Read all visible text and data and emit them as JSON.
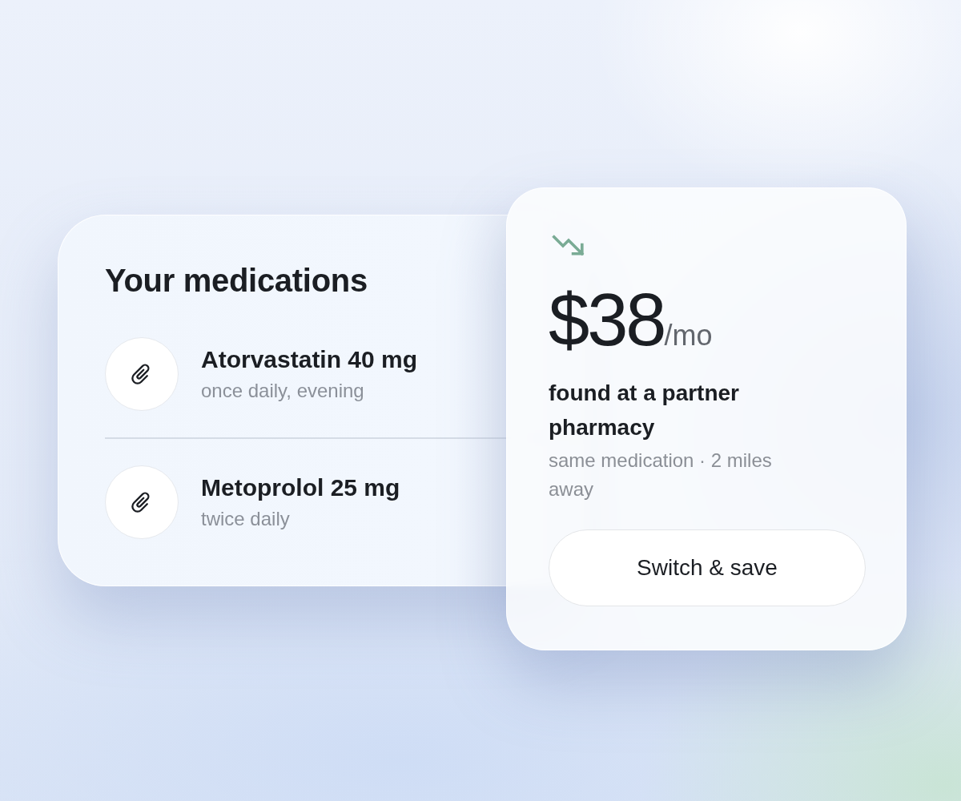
{
  "medications_card": {
    "title": "Your medications",
    "items": [
      {
        "name": "Atorvastatin 40 mg",
        "schedule": "once daily, evening"
      },
      {
        "name": "Metoprolol 25 mg",
        "schedule": "twice daily"
      }
    ]
  },
  "offer_card": {
    "price": "$38",
    "period": "/mo",
    "headline": "found at a partner pharmacy",
    "detail": "same medication · 2 miles away",
    "button": "Switch & save"
  }
}
